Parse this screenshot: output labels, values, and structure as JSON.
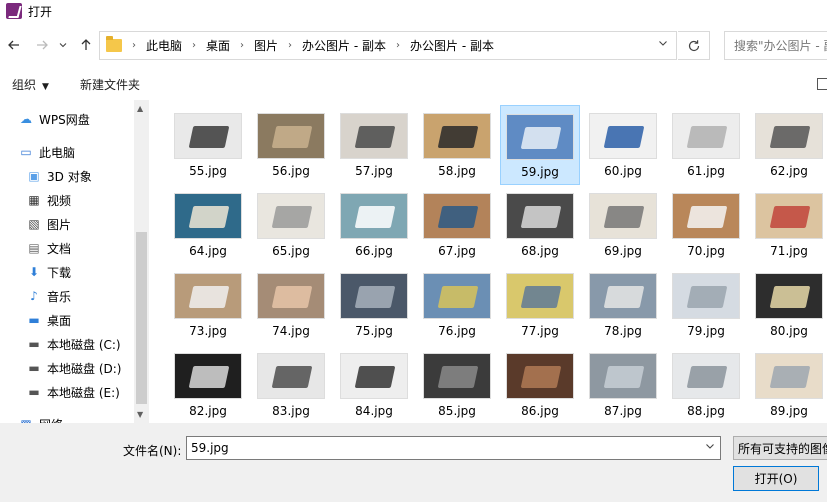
{
  "window": {
    "title": "打开"
  },
  "nav": {
    "back_icon": "arrow-left-icon",
    "forward_icon": "arrow-right-icon",
    "recent_icon": "chevron-down-icon",
    "up_icon": "arrow-up-icon",
    "breadcrumbs": [
      "此电脑",
      "桌面",
      "图片",
      "办公图片 - 副本",
      "办公图片 - 副本"
    ],
    "refresh_icon": "refresh-icon",
    "search_placeholder": "搜索\"办公图片 - 副"
  },
  "toolbar": {
    "organize_label": "组织",
    "new_folder_label": "新建文件夹"
  },
  "sidebar": {
    "items": [
      {
        "label": "WPS网盘",
        "icon": "cloud-icon",
        "color": "#3a8fe0"
      },
      {
        "label": "此电脑",
        "icon": "computer-icon",
        "color": "#3a7bd5"
      },
      {
        "label": "3D 对象",
        "icon": "cube-icon",
        "color": "#5aa0e8"
      },
      {
        "label": "视频",
        "icon": "video-icon",
        "color": "#333333"
      },
      {
        "label": "图片",
        "icon": "picture-icon",
        "color": "#444444"
      },
      {
        "label": "文档",
        "icon": "document-icon",
        "color": "#666666"
      },
      {
        "label": "下载",
        "icon": "download-icon",
        "color": "#2f7fd8"
      },
      {
        "label": "音乐",
        "icon": "music-icon",
        "color": "#2f7fd8"
      },
      {
        "label": "桌面",
        "icon": "desktop-icon",
        "color": "#2f7fd8"
      },
      {
        "label": "本地磁盘 (C:)",
        "icon": "drive-icon",
        "color": "#555555"
      },
      {
        "label": "本地磁盘 (D:)",
        "icon": "drive-icon",
        "color": "#555555"
      },
      {
        "label": "本地磁盘 (E:)",
        "icon": "drive-icon",
        "color": "#555555"
      },
      {
        "label": "网络",
        "icon": "network-icon",
        "color": "#3a7bd5"
      }
    ]
  },
  "files": [
    {
      "name": "55.jpg",
      "bg": "#e9e9e9",
      "fg": "#3a3a3a"
    },
    {
      "name": "56.jpg",
      "bg": "#8b7a60",
      "fg": "#c9b28e"
    },
    {
      "name": "57.jpg",
      "bg": "#d8d3cc",
      "fg": "#4a4a4a"
    },
    {
      "name": "58.jpg",
      "bg": "#c9a36e",
      "fg": "#2a2a2a"
    },
    {
      "name": "59.jpg",
      "bg": "#5f8bc4",
      "fg": "#e7eef7"
    },
    {
      "name": "60.jpg",
      "bg": "#f1f1f1",
      "fg": "#2b5fa8"
    },
    {
      "name": "61.jpg",
      "bg": "#ededed",
      "fg": "#b0b0b0"
    },
    {
      "name": "62.jpg",
      "bg": "#e6e1d9",
      "fg": "#555555"
    },
    {
      "name": "64.jpg",
      "bg": "#2f6a8a",
      "fg": "#efe6d3"
    },
    {
      "name": "65.jpg",
      "bg": "#e9e6df",
      "fg": "#9a9a9a"
    },
    {
      "name": "66.jpg",
      "bg": "#7fa7b3",
      "fg": "#ffffff"
    },
    {
      "name": "67.jpg",
      "bg": "#b3835a",
      "fg": "#2c5a86"
    },
    {
      "name": "68.jpg",
      "bg": "#4a4a4a",
      "fg": "#d9d9d9"
    },
    {
      "name": "69.jpg",
      "bg": "#e7e2d8",
      "fg": "#777777"
    },
    {
      "name": "70.jpg",
      "bg": "#b9875a",
      "fg": "#f4f4f4"
    },
    {
      "name": "71.jpg",
      "bg": "#dcc4a0",
      "fg": "#c1453b"
    },
    {
      "name": "73.jpg",
      "bg": "#b89b7a",
      "fg": "#f0f0f0"
    },
    {
      "name": "74.jpg",
      "bg": "#a58c76",
      "fg": "#e6c4a8"
    },
    {
      "name": "75.jpg",
      "bg": "#4b5869",
      "fg": "#a7b0bc"
    },
    {
      "name": "76.jpg",
      "bg": "#6b8fb4",
      "fg": "#d7c35a"
    },
    {
      "name": "77.jpg",
      "bg": "#d9c86c",
      "fg": "#5f7a96"
    },
    {
      "name": "78.jpg",
      "bg": "#8899aa",
      "fg": "#e5e5e5"
    },
    {
      "name": "79.jpg",
      "bg": "#d5dbe2",
      "fg": "#9aa4ae"
    },
    {
      "name": "80.jpg",
      "bg": "#2d2d2d",
      "fg": "#e8d9a8"
    },
    {
      "name": "82.jpg",
      "bg": "#1f1f1f",
      "fg": "#d9d9d9"
    },
    {
      "name": "83.jpg",
      "bg": "#e7e7e7",
      "fg": "#4d4d4d"
    },
    {
      "name": "84.jpg",
      "bg": "#eeeeee",
      "fg": "#333333"
    },
    {
      "name": "85.jpg",
      "bg": "#3b3b3b",
      "fg": "#8a8a8a"
    },
    {
      "name": "86.jpg",
      "bg": "#5a3a2a",
      "fg": "#b07a55"
    },
    {
      "name": "87.jpg",
      "bg": "#8e98a1",
      "fg": "#c7ced5"
    },
    {
      "name": "88.jpg",
      "bg": "#e6e8ea",
      "fg": "#8b949c"
    },
    {
      "name": "89.jpg",
      "bg": "#e8dcc9",
      "fg": "#9da7b0"
    }
  ],
  "selected_file": "59.jpg",
  "bottom": {
    "filename_label": "文件名(N):",
    "filename_value": "59.jpg",
    "filetype_value": "所有可支持的图像",
    "open_label": "打开(O)"
  },
  "colors": {
    "selection_bg": "#cce8ff",
    "selection_border": "#99d1ff",
    "accent": "#0078d7"
  }
}
